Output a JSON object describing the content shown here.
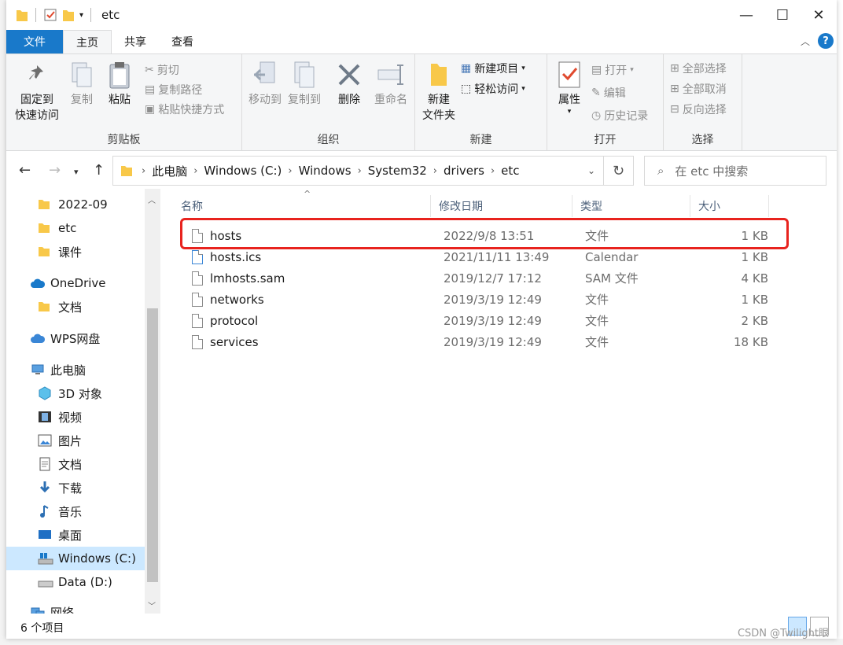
{
  "title": "etc",
  "tabs": {
    "file": "文件",
    "home": "主页",
    "share": "共享",
    "view": "查看"
  },
  "ribbon": {
    "clipboard": {
      "label": "剪贴板",
      "pin_line1": "固定到",
      "pin_line2": "快速访问",
      "copy": "复制",
      "paste": "粘贴",
      "cut": "剪切",
      "copy_path": "复制路径",
      "paste_shortcut": "粘贴快捷方式"
    },
    "organize": {
      "label": "组织",
      "move_to": "移动到",
      "copy_to": "复制到",
      "delete": "删除",
      "rename": "重命名"
    },
    "new": {
      "label": "新建",
      "new_folder_line1": "新建",
      "new_folder_line2": "文件夹",
      "new_item": "新建项目",
      "easy_access": "轻松访问"
    },
    "open": {
      "label": "打开",
      "properties": "属性",
      "open": "打开",
      "edit": "编辑",
      "history": "历史记录"
    },
    "select": {
      "label": "选择",
      "select_all": "全部选择",
      "select_none": "全部取消",
      "invert": "反向选择"
    }
  },
  "address": {
    "crumbs": [
      "此电脑",
      "Windows (C:)",
      "Windows",
      "System32",
      "drivers",
      "etc"
    ],
    "search_placeholder": "在 etc 中搜索"
  },
  "nav": [
    {
      "label": "2022-09",
      "icon": "folder-icon"
    },
    {
      "label": "etc",
      "icon": "folder-icon"
    },
    {
      "label": "课件",
      "icon": "folder-icon"
    },
    {
      "label": "OneDrive",
      "icon": "cloud-icon"
    },
    {
      "label": "文档",
      "icon": "folder-icon"
    },
    {
      "label": "WPS网盘",
      "icon": "cloud-icon"
    },
    {
      "label": "此电脑",
      "icon": "computer-icon"
    },
    {
      "label": "3D 对象",
      "icon": "cube-icon"
    },
    {
      "label": "视频",
      "icon": "video-icon"
    },
    {
      "label": "图片",
      "icon": "picture-icon"
    },
    {
      "label": "文档",
      "icon": "document-icon"
    },
    {
      "label": "下载",
      "icon": "download-icon"
    },
    {
      "label": "音乐",
      "icon": "music-icon"
    },
    {
      "label": "桌面",
      "icon": "desktop-icon"
    },
    {
      "label": "Windows (C:)",
      "icon": "drive-icon"
    },
    {
      "label": "Data (D:)",
      "icon": "drive-icon"
    },
    {
      "label": "网络",
      "icon": "network-icon"
    }
  ],
  "columns": {
    "name": "名称",
    "date": "修改日期",
    "type": "类型",
    "size": "大小"
  },
  "files": [
    {
      "name": "hosts",
      "date": "2022/9/8 13:51",
      "type": "文件",
      "size": "1 KB"
    },
    {
      "name": "hosts.ics",
      "date": "2021/11/11 13:49",
      "type": "Calendar",
      "size": "1 KB"
    },
    {
      "name": "lmhosts.sam",
      "date": "2019/12/7 17:12",
      "type": "SAM 文件",
      "size": "4 KB"
    },
    {
      "name": "networks",
      "date": "2019/3/19 12:49",
      "type": "文件",
      "size": "1 KB"
    },
    {
      "name": "protocol",
      "date": "2019/3/19 12:49",
      "type": "文件",
      "size": "2 KB"
    },
    {
      "name": "services",
      "date": "2019/3/19 12:49",
      "type": "文件",
      "size": "18 KB"
    }
  ],
  "status": {
    "item_count": "6 个项目"
  },
  "watermark": "CSDN @Twilight眼",
  "colors": {
    "accent": "#1979ca",
    "highlight": "#e8231e",
    "selected": "#cce8ff",
    "folder": "#f8c849"
  }
}
